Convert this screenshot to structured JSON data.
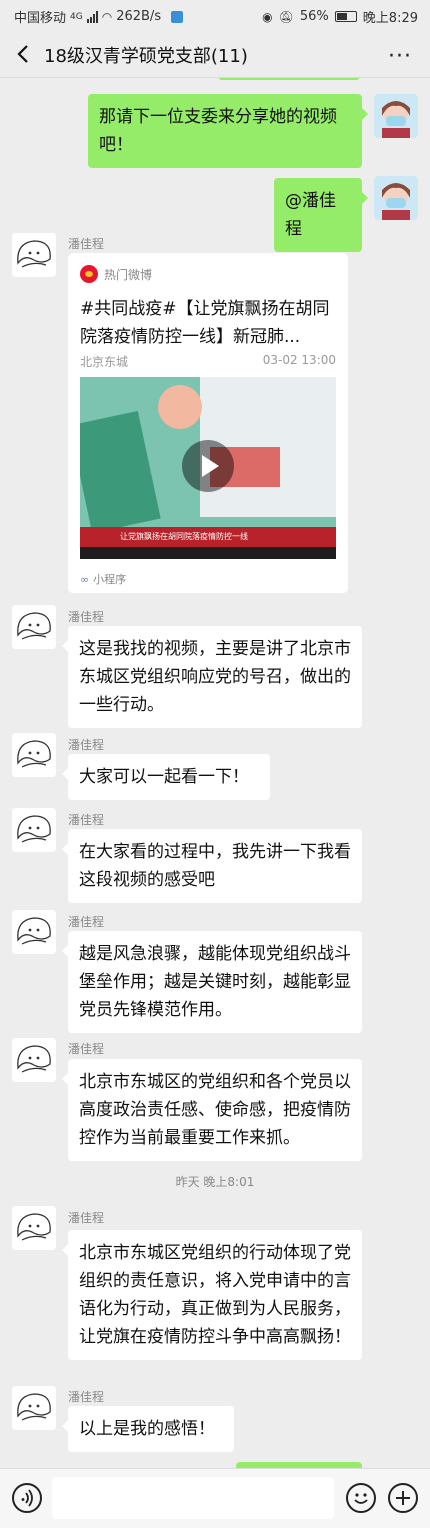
{
  "status_bar": {
    "carrier": "中国移动",
    "network": "4G",
    "speed": "262B/s",
    "battery": "56%",
    "time": "晚上8:29"
  },
  "header": {
    "title": "18级汉青学硕党支部(11)",
    "more": "···"
  },
  "messages": [
    {
      "from": "me",
      "text": "那请下一位支委来分享她的视频吧！"
    },
    {
      "from": "me",
      "text": "@潘佳程"
    },
    {
      "from": "潘佳程",
      "type": "mini_program",
      "source": "热门微博",
      "title": "#共同战疫#【让党旗飘扬在胡同院落疫情防控一线】新冠肺...",
      "location": "北京东城",
      "datetime": "03-02 13:00",
      "footer": "小程序"
    },
    {
      "from": "潘佳程",
      "text": "这是我找的视频，主要是讲了北京市东城区党组织响应党的号召，做出的一些行动。"
    },
    {
      "from": "潘佳程",
      "text": "大家可以一起看一下！"
    },
    {
      "from": "潘佳程",
      "text": "在大家看的过程中，我先讲一下我看这段视频的感受吧"
    },
    {
      "from": "潘佳程",
      "text": "越是风急浪骤，越能体现党组织战斗堡垒作用；越是关键时刻，越能彰显党员先锋模范作用。"
    },
    {
      "from": "潘佳程",
      "text": "北京市东城区的党组织和各个党员以高度政治责任感、使命感，把疫情防控作为当前最重要工作来抓。"
    },
    {
      "type": "time",
      "text": "昨天 晚上8:01"
    },
    {
      "from": "潘佳程",
      "text": "北京市东城区党组织的行动体现了党组织的责任意识，将入党申请中的言语化为行动，真正做到为人民服务，让党旗在疫情防控斗争中高高飘扬！"
    },
    {
      "from": "潘佳程",
      "text": "以上是我的感悟！"
    }
  ],
  "colors": {
    "background": "#ededed",
    "my_bubble": "#95ec69",
    "other_bubble": "#ffffff"
  },
  "icons": [
    "back-icon",
    "more-icon",
    "voice-icon",
    "emoji-icon",
    "plus-icon",
    "play-icon",
    "weibo-icon",
    "mini-program-icon"
  ]
}
